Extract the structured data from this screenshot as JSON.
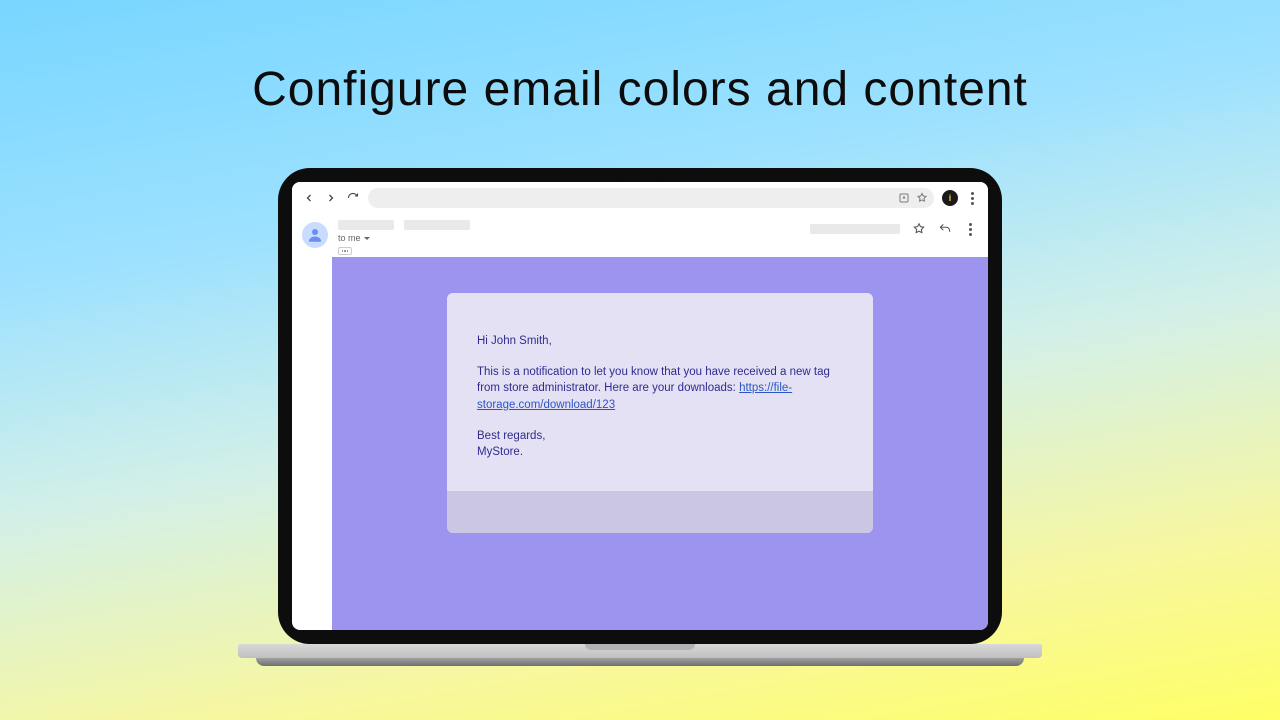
{
  "headline": "Configure email colors and content",
  "browser": {
    "profile_initial": "i"
  },
  "mail": {
    "recipient_label": "to me"
  },
  "email": {
    "greeting": "Hi John Smith,",
    "body_pre": "This is a notification to let you know that you have received a new tag from store administrator. Here are your downloads: ",
    "link_text": "https://file-storage.com/download/123",
    "signoff1": "Best regards,",
    "signoff2": "MyStore."
  },
  "colors": {
    "email_bg": "#9d94f0",
    "card_top": "#e5e1f5",
    "card_bottom": "#cbc6e3",
    "text": "#2f2b8f"
  }
}
